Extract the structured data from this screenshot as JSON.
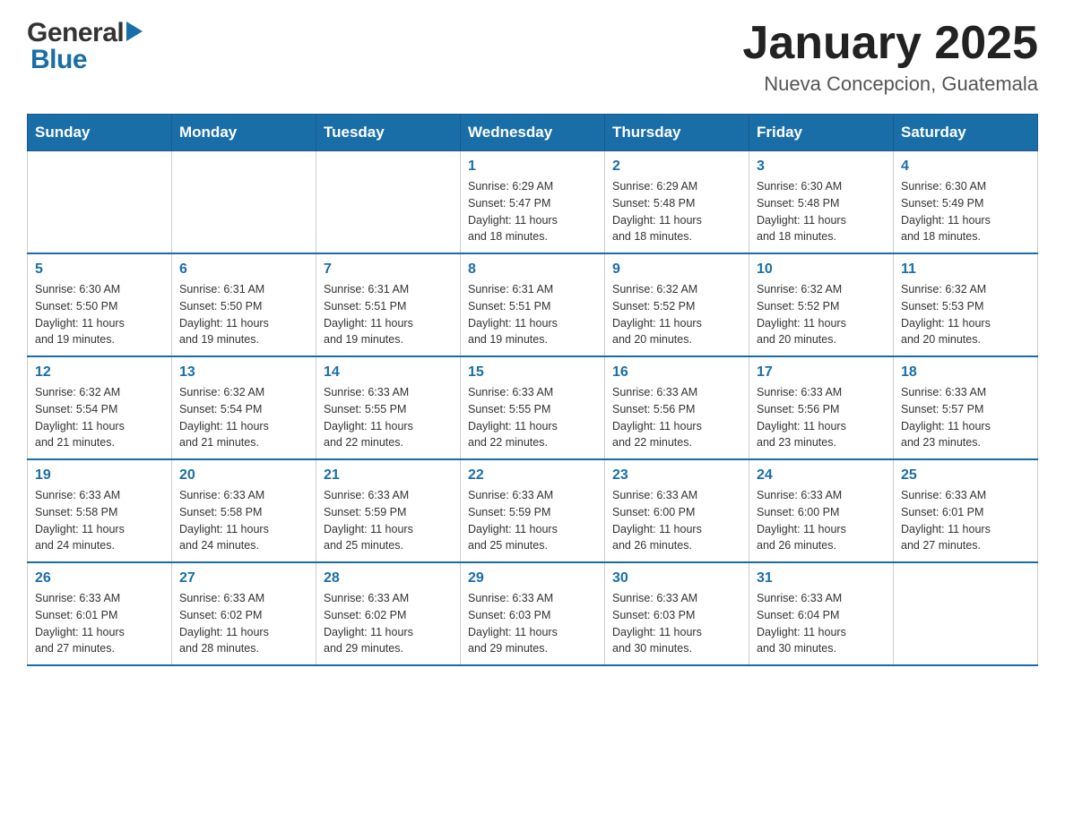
{
  "header": {
    "logo_general": "General",
    "logo_blue": "Blue",
    "title": "January 2025",
    "subtitle": "Nueva Concepcion, Guatemala"
  },
  "calendar": {
    "days_of_week": [
      "Sunday",
      "Monday",
      "Tuesday",
      "Wednesday",
      "Thursday",
      "Friday",
      "Saturday"
    ],
    "weeks": [
      [
        {
          "day": "",
          "info": ""
        },
        {
          "day": "",
          "info": ""
        },
        {
          "day": "",
          "info": ""
        },
        {
          "day": "1",
          "info": "Sunrise: 6:29 AM\nSunset: 5:47 PM\nDaylight: 11 hours\nand 18 minutes."
        },
        {
          "day": "2",
          "info": "Sunrise: 6:29 AM\nSunset: 5:48 PM\nDaylight: 11 hours\nand 18 minutes."
        },
        {
          "day": "3",
          "info": "Sunrise: 6:30 AM\nSunset: 5:48 PM\nDaylight: 11 hours\nand 18 minutes."
        },
        {
          "day": "4",
          "info": "Sunrise: 6:30 AM\nSunset: 5:49 PM\nDaylight: 11 hours\nand 18 minutes."
        }
      ],
      [
        {
          "day": "5",
          "info": "Sunrise: 6:30 AM\nSunset: 5:50 PM\nDaylight: 11 hours\nand 19 minutes."
        },
        {
          "day": "6",
          "info": "Sunrise: 6:31 AM\nSunset: 5:50 PM\nDaylight: 11 hours\nand 19 minutes."
        },
        {
          "day": "7",
          "info": "Sunrise: 6:31 AM\nSunset: 5:51 PM\nDaylight: 11 hours\nand 19 minutes."
        },
        {
          "day": "8",
          "info": "Sunrise: 6:31 AM\nSunset: 5:51 PM\nDaylight: 11 hours\nand 19 minutes."
        },
        {
          "day": "9",
          "info": "Sunrise: 6:32 AM\nSunset: 5:52 PM\nDaylight: 11 hours\nand 20 minutes."
        },
        {
          "day": "10",
          "info": "Sunrise: 6:32 AM\nSunset: 5:52 PM\nDaylight: 11 hours\nand 20 minutes."
        },
        {
          "day": "11",
          "info": "Sunrise: 6:32 AM\nSunset: 5:53 PM\nDaylight: 11 hours\nand 20 minutes."
        }
      ],
      [
        {
          "day": "12",
          "info": "Sunrise: 6:32 AM\nSunset: 5:54 PM\nDaylight: 11 hours\nand 21 minutes."
        },
        {
          "day": "13",
          "info": "Sunrise: 6:32 AM\nSunset: 5:54 PM\nDaylight: 11 hours\nand 21 minutes."
        },
        {
          "day": "14",
          "info": "Sunrise: 6:33 AM\nSunset: 5:55 PM\nDaylight: 11 hours\nand 22 minutes."
        },
        {
          "day": "15",
          "info": "Sunrise: 6:33 AM\nSunset: 5:55 PM\nDaylight: 11 hours\nand 22 minutes."
        },
        {
          "day": "16",
          "info": "Sunrise: 6:33 AM\nSunset: 5:56 PM\nDaylight: 11 hours\nand 22 minutes."
        },
        {
          "day": "17",
          "info": "Sunrise: 6:33 AM\nSunset: 5:56 PM\nDaylight: 11 hours\nand 23 minutes."
        },
        {
          "day": "18",
          "info": "Sunrise: 6:33 AM\nSunset: 5:57 PM\nDaylight: 11 hours\nand 23 minutes."
        }
      ],
      [
        {
          "day": "19",
          "info": "Sunrise: 6:33 AM\nSunset: 5:58 PM\nDaylight: 11 hours\nand 24 minutes."
        },
        {
          "day": "20",
          "info": "Sunrise: 6:33 AM\nSunset: 5:58 PM\nDaylight: 11 hours\nand 24 minutes."
        },
        {
          "day": "21",
          "info": "Sunrise: 6:33 AM\nSunset: 5:59 PM\nDaylight: 11 hours\nand 25 minutes."
        },
        {
          "day": "22",
          "info": "Sunrise: 6:33 AM\nSunset: 5:59 PM\nDaylight: 11 hours\nand 25 minutes."
        },
        {
          "day": "23",
          "info": "Sunrise: 6:33 AM\nSunset: 6:00 PM\nDaylight: 11 hours\nand 26 minutes."
        },
        {
          "day": "24",
          "info": "Sunrise: 6:33 AM\nSunset: 6:00 PM\nDaylight: 11 hours\nand 26 minutes."
        },
        {
          "day": "25",
          "info": "Sunrise: 6:33 AM\nSunset: 6:01 PM\nDaylight: 11 hours\nand 27 minutes."
        }
      ],
      [
        {
          "day": "26",
          "info": "Sunrise: 6:33 AM\nSunset: 6:01 PM\nDaylight: 11 hours\nand 27 minutes."
        },
        {
          "day": "27",
          "info": "Sunrise: 6:33 AM\nSunset: 6:02 PM\nDaylight: 11 hours\nand 28 minutes."
        },
        {
          "day": "28",
          "info": "Sunrise: 6:33 AM\nSunset: 6:02 PM\nDaylight: 11 hours\nand 29 minutes."
        },
        {
          "day": "29",
          "info": "Sunrise: 6:33 AM\nSunset: 6:03 PM\nDaylight: 11 hours\nand 29 minutes."
        },
        {
          "day": "30",
          "info": "Sunrise: 6:33 AM\nSunset: 6:03 PM\nDaylight: 11 hours\nand 30 minutes."
        },
        {
          "day": "31",
          "info": "Sunrise: 6:33 AM\nSunset: 6:04 PM\nDaylight: 11 hours\nand 30 minutes."
        },
        {
          "day": "",
          "info": ""
        }
      ]
    ]
  }
}
